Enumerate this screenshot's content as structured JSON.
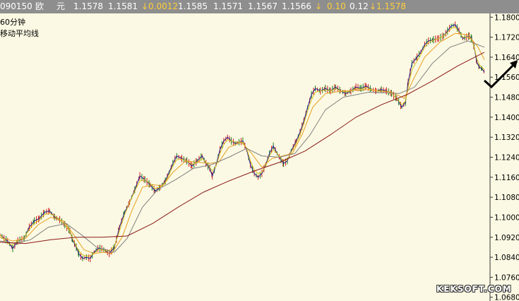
{
  "quote": {
    "code": "090150",
    "name_1": "欧",
    "name_2": "元",
    "last": "1.1578",
    "open": "1.1581",
    "change": "↓0.0012",
    "high": "1.1585",
    "low": "1.1571",
    "prev": "1.1567",
    "current": "1.1566",
    "arrow": "↓",
    "pct": "0.10",
    "amp": "0.12",
    "ref": "↓1.1578"
  },
  "legend": {
    "period": "60分钟",
    "indicator": "移动平均线"
  },
  "watermark": "KEKSOFT.COM",
  "chart_data": {
    "type": "line",
    "period": "60分钟",
    "y_ticks": [
      "1.1800",
      "1.1720",
      "1.1640",
      "1.1560",
      "1.1480",
      "1.1400",
      "1.1320",
      "1.1240",
      "1.1160",
      "1.1080",
      "1.1000",
      "1.0920",
      "1.0840",
      "1.0760",
      "1.0680"
    ],
    "ylim": [
      1.0665,
      1.1815
    ],
    "x_count": 205,
    "price": [
      [
        0,
        1.093
      ],
      [
        6,
        1.0905
      ],
      [
        10,
        1.0875
      ],
      [
        14,
        1.0905
      ],
      [
        19,
        1.0915
      ],
      [
        23,
        1.096
      ],
      [
        27,
        1.0985
      ],
      [
        31,
        1.0995
      ],
      [
        35,
        1.102
      ],
      [
        39,
        1.1025
      ],
      [
        43,
        1.1
      ],
      [
        47,
        1.099
      ],
      [
        51,
        1.097
      ],
      [
        55,
        1.0945
      ],
      [
        57,
        1.091
      ],
      [
        60,
        1.088
      ],
      [
        62,
        1.0855
      ],
      [
        65,
        1.0835
      ],
      [
        68,
        1.084
      ],
      [
        71,
        1.0835
      ],
      [
        74,
        1.086
      ],
      [
        77,
        1.0875
      ],
      [
        80,
        1.0875
      ],
      [
        83,
        1.0865
      ],
      [
        86,
        1.0855
      ],
      [
        90,
        1.088
      ],
      [
        94,
        1.096
      ],
      [
        98,
        1.102
      ],
      [
        102,
        1.106
      ],
      [
        106,
        1.111
      ],
      [
        110,
        1.1165
      ],
      [
        114,
        1.115
      ],
      [
        118,
        1.113
      ],
      [
        122,
        1.1105
      ],
      [
        126,
        1.112
      ],
      [
        130,
        1.1145
      ],
      [
        133,
        1.118
      ],
      [
        136,
        1.1215
      ],
      [
        139,
        1.1245
      ],
      [
        143,
        1.1235
      ],
      [
        147,
        1.1225
      ],
      [
        151,
        1.1205
      ],
      [
        155,
        1.1225
      ],
      [
        159,
        1.1245
      ],
      [
        162,
        1.1215
      ],
      [
        165,
        1.1195
      ],
      [
        167,
        1.1165
      ],
      [
        170,
        1.121
      ],
      [
        173,
        1.127
      ],
      [
        176,
        1.1305
      ],
      [
        179,
        1.132
      ],
      [
        182,
        1.1305
      ],
      [
        185,
        1.1295
      ],
      [
        188,
        1.13
      ],
      [
        191,
        1.1305
      ],
      [
        194,
        1.127
      ],
      [
        197,
        1.121
      ],
      [
        200,
        1.1175
      ],
      [
        203,
        1.116
      ],
      [
        206,
        1.1175
      ],
      [
        209,
        1.121
      ],
      [
        212,
        1.1255
      ],
      [
        215,
        1.1285
      ],
      [
        218,
        1.1255
      ],
      [
        221,
        1.123
      ],
      [
        223,
        1.1215
      ],
      [
        226,
        1.1225
      ],
      [
        229,
        1.1265
      ],
      [
        233,
        1.1305
      ],
      [
        236,
        1.134
      ],
      [
        239,
        1.1385
      ],
      [
        242,
        1.144
      ],
      [
        245,
        1.149
      ],
      [
        248,
        1.1515
      ],
      [
        252,
        1.1505
      ],
      [
        256,
        1.1515
      ],
      [
        260,
        1.1505
      ],
      [
        264,
        1.152
      ],
      [
        268,
        1.1505
      ],
      [
        272,
        1.1495
      ],
      [
        276,
        1.1505
      ],
      [
        280,
        1.152
      ],
      [
        284,
        1.1515
      ],
      [
        288,
        1.1525
      ],
      [
        292,
        1.151
      ],
      [
        296,
        1.1505
      ],
      [
        300,
        1.151
      ],
      [
        304,
        1.1505
      ],
      [
        308,
        1.1495
      ],
      [
        312,
        1.1475
      ],
      [
        316,
        1.144
      ],
      [
        319,
        1.146
      ],
      [
        321,
        1.154
      ],
      [
        324,
        1.1615
      ],
      [
        328,
        1.164
      ],
      [
        331,
        1.166
      ],
      [
        334,
        1.169
      ],
      [
        337,
        1.1705
      ],
      [
        341,
        1.171
      ],
      [
        345,
        1.1715
      ],
      [
        349,
        1.1725
      ],
      [
        352,
        1.1745
      ],
      [
        355,
        1.1765
      ],
      [
        358,
        1.177
      ],
      [
        361,
        1.1745
      ],
      [
        364,
        1.1715
      ],
      [
        367,
        1.172
      ],
      [
        369,
        1.1725
      ],
      [
        371,
        1.1715
      ],
      [
        373,
        1.168
      ],
      [
        375,
        1.162
      ],
      [
        377,
        1.16
      ],
      [
        379,
        1.1595
      ],
      [
        381,
        1.158
      ]
    ],
    "ma5": [
      [
        0,
        1.093
      ],
      [
        6,
        1.0895
      ],
      [
        10,
        1.089
      ],
      [
        14,
        1.0905
      ],
      [
        19,
        1.092
      ],
      [
        23,
        1.095
      ],
      [
        27,
        1.0975
      ],
      [
        31,
        1.099
      ],
      [
        35,
        1.101
      ],
      [
        39,
        1.1015
      ],
      [
        43,
        1.1005
      ],
      [
        47,
        1.099
      ],
      [
        51,
        1.097
      ],
      [
        55,
        1.0945
      ],
      [
        57,
        1.0915
      ],
      [
        60,
        1.0885
      ],
      [
        62,
        1.0865
      ],
      [
        65,
        1.085
      ],
      [
        68,
        1.0845
      ],
      [
        71,
        1.0845
      ],
      [
        74,
        1.0855
      ],
      [
        77,
        1.087
      ],
      [
        80,
        1.087
      ],
      [
        83,
        1.0866
      ],
      [
        86,
        1.0865
      ],
      [
        90,
        1.0885
      ],
      [
        94,
        1.0945
      ],
      [
        98,
        1.101
      ],
      [
        102,
        1.106
      ],
      [
        106,
        1.1105
      ],
      [
        110,
        1.1145
      ],
      [
        114,
        1.115
      ],
      [
        118,
        1.1135
      ],
      [
        122,
        1.1115
      ],
      [
        126,
        1.112
      ],
      [
        130,
        1.114
      ],
      [
        133,
        1.117
      ],
      [
        136,
        1.1205
      ],
      [
        139,
        1.123
      ],
      [
        143,
        1.1232
      ],
      [
        147,
        1.1225
      ],
      [
        151,
        1.121
      ],
      [
        155,
        1.122
      ],
      [
        159,
        1.1235
      ],
      [
        162,
        1.122
      ],
      [
        165,
        1.12
      ],
      [
        167,
        1.1185
      ],
      [
        170,
        1.1205
      ],
      [
        173,
        1.1255
      ],
      [
        176,
        1.129
      ],
      [
        179,
        1.131
      ],
      [
        182,
        1.1305
      ],
      [
        185,
        1.13
      ],
      [
        188,
        1.13
      ],
      [
        191,
        1.13
      ],
      [
        194,
        1.1275
      ],
      [
        197,
        1.1225
      ],
      [
        200,
        1.119
      ],
      [
        203,
        1.1175
      ],
      [
        206,
        1.118
      ],
      [
        209,
        1.1205
      ],
      [
        212,
        1.1245
      ],
      [
        215,
        1.127
      ],
      [
        218,
        1.1255
      ],
      [
        221,
        1.1235
      ],
      [
        223,
        1.1225
      ],
      [
        226,
        1.123
      ],
      [
        229,
        1.126
      ],
      [
        233,
        1.1295
      ],
      [
        236,
        1.133
      ],
      [
        239,
        1.1375
      ],
      [
        242,
        1.1425
      ],
      [
        245,
        1.147
      ],
      [
        248,
        1.15
      ],
      [
        252,
        1.1505
      ],
      [
        256,
        1.151
      ],
      [
        260,
        1.1505
      ],
      [
        264,
        1.1515
      ],
      [
        268,
        1.1505
      ],
      [
        272,
        1.15
      ],
      [
        276,
        1.1505
      ],
      [
        280,
        1.1515
      ],
      [
        284,
        1.1513
      ],
      [
        288,
        1.152
      ],
      [
        292,
        1.151
      ],
      [
        296,
        1.1505
      ],
      [
        300,
        1.1505
      ],
      [
        304,
        1.1503
      ],
      [
        308,
        1.1495
      ],
      [
        312,
        1.1475
      ],
      [
        316,
        1.145
      ],
      [
        319,
        1.1465
      ],
      [
        321,
        1.152
      ],
      [
        324,
        1.159
      ],
      [
        328,
        1.1625
      ],
      [
        331,
        1.165
      ],
      [
        334,
        1.168
      ],
      [
        337,
        1.17
      ],
      [
        341,
        1.1708
      ],
      [
        345,
        1.1715
      ],
      [
        349,
        1.1725
      ],
      [
        352,
        1.174
      ],
      [
        355,
        1.1755
      ],
      [
        358,
        1.176
      ],
      [
        361,
        1.174
      ],
      [
        364,
        1.172
      ],
      [
        367,
        1.172
      ],
      [
        369,
        1.172
      ],
      [
        371,
        1.171
      ],
      [
        373,
        1.168
      ],
      [
        375,
        1.1635
      ],
      [
        377,
        1.161
      ],
      [
        379,
        1.16
      ],
      [
        381,
        1.159
      ]
    ],
    "ma10": [
      [
        0,
        1.092
      ],
      [
        10,
        1.0905
      ],
      [
        20,
        1.0915
      ],
      [
        30,
        1.097
      ],
      [
        40,
        1.1
      ],
      [
        50,
        1.0985
      ],
      [
        58,
        1.093
      ],
      [
        66,
        1.087
      ],
      [
        74,
        1.0855
      ],
      [
        82,
        1.086
      ],
      [
        88,
        1.0855
      ],
      [
        96,
        1.092
      ],
      [
        104,
        1.103
      ],
      [
        112,
        1.112
      ],
      [
        120,
        1.113
      ],
      [
        128,
        1.1125
      ],
      [
        136,
        1.118
      ],
      [
        146,
        1.1225
      ],
      [
        156,
        1.122
      ],
      [
        164,
        1.1215
      ],
      [
        172,
        1.122
      ],
      [
        180,
        1.128
      ],
      [
        190,
        1.13
      ],
      [
        198,
        1.1255
      ],
      [
        206,
        1.12
      ],
      [
        214,
        1.1235
      ],
      [
        222,
        1.1245
      ],
      [
        230,
        1.1255
      ],
      [
        238,
        1.1335
      ],
      [
        246,
        1.144
      ],
      [
        256,
        1.1495
      ],
      [
        270,
        1.1505
      ],
      [
        290,
        1.151
      ],
      [
        308,
        1.15
      ],
      [
        318,
        1.1475
      ],
      [
        326,
        1.156
      ],
      [
        334,
        1.164
      ],
      [
        346,
        1.17
      ],
      [
        358,
        1.1735
      ],
      [
        368,
        1.173
      ],
      [
        376,
        1.168
      ],
      [
        381,
        1.163
      ]
    ],
    "ma20": [
      [
        0,
        1.0905
      ],
      [
        12,
        1.0895
      ],
      [
        24,
        1.091
      ],
      [
        38,
        1.096
      ],
      [
        52,
        1.0975
      ],
      [
        64,
        1.093
      ],
      [
        76,
        1.088
      ],
      [
        90,
        1.086
      ],
      [
        100,
        1.0915
      ],
      [
        112,
        1.104
      ],
      [
        124,
        1.111
      ],
      [
        138,
        1.115
      ],
      [
        152,
        1.1195
      ],
      [
        166,
        1.121
      ],
      [
        180,
        1.124
      ],
      [
        194,
        1.1275
      ],
      [
        206,
        1.1245
      ],
      [
        220,
        1.124
      ],
      [
        232,
        1.1255
      ],
      [
        244,
        1.133
      ],
      [
        256,
        1.143
      ],
      [
        270,
        1.148
      ],
      [
        290,
        1.15
      ],
      [
        314,
        1.1495
      ],
      [
        326,
        1.152
      ],
      [
        340,
        1.1615
      ],
      [
        354,
        1.168
      ],
      [
        368,
        1.1705
      ],
      [
        381,
        1.168
      ]
    ],
    "ma60": [
      [
        0,
        1.09
      ],
      [
        20,
        1.0895
      ],
      [
        40,
        1.091
      ],
      [
        60,
        1.092
      ],
      [
        80,
        1.092
      ],
      [
        100,
        1.0925
      ],
      [
        120,
        1.0975
      ],
      [
        140,
        1.104
      ],
      [
        160,
        1.11
      ],
      [
        180,
        1.1145
      ],
      [
        200,
        1.1185
      ],
      [
        220,
        1.122
      ],
      [
        240,
        1.1265
      ],
      [
        260,
        1.133
      ],
      [
        280,
        1.14
      ],
      [
        300,
        1.145
      ],
      [
        320,
        1.149
      ],
      [
        340,
        1.1545
      ],
      [
        360,
        1.1605
      ],
      [
        381,
        1.166
      ]
    ],
    "series": [
      {
        "key": "price",
        "color": "#1e1a8a",
        "width": 1
      },
      {
        "key": "ma5",
        "color": "#d8c31c",
        "width": 1
      },
      {
        "key": "ma10",
        "color": "#e8a020",
        "width": 1
      },
      {
        "key": "ma20",
        "color": "#808080",
        "width": 1
      },
      {
        "key": "ma60",
        "color": "#8b1a1a",
        "width": 1
      }
    ],
    "annotation": "trend-arrow"
  }
}
